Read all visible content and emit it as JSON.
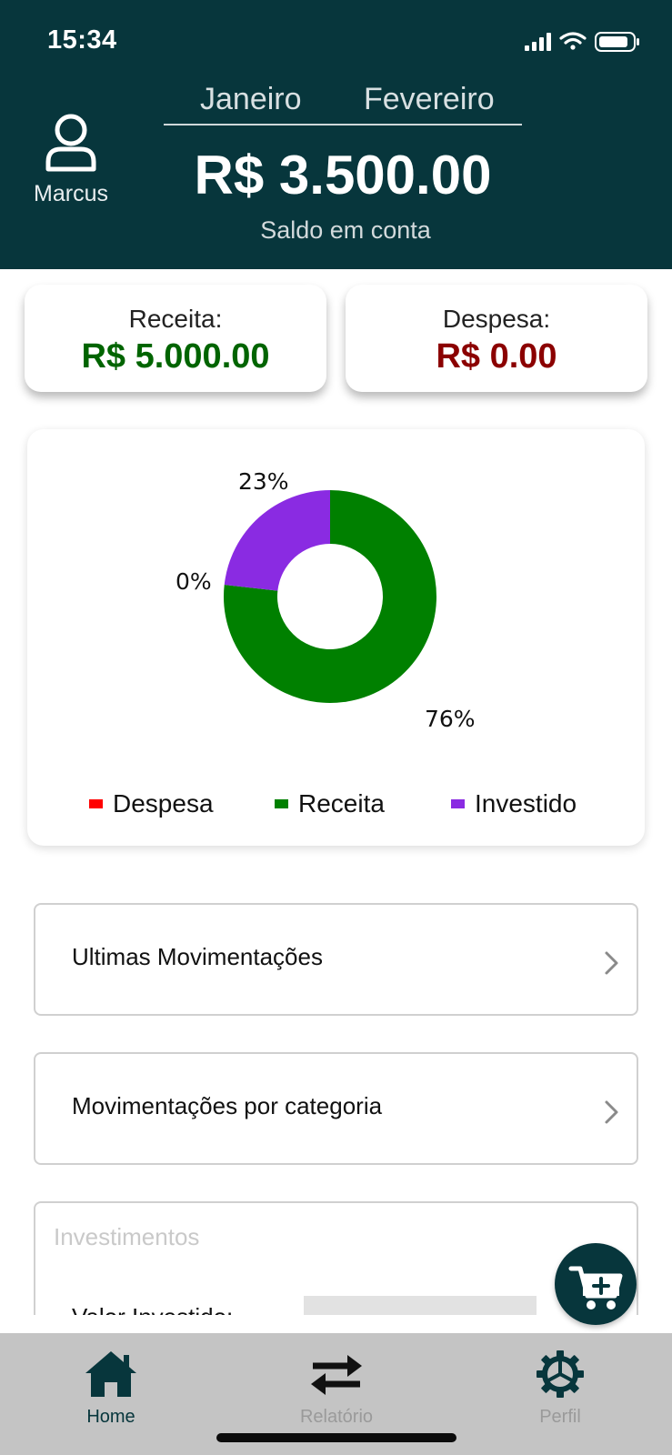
{
  "status_bar": {
    "time": "15:34"
  },
  "header": {
    "user_name": "Marcus",
    "months": [
      "Janeiro",
      "Fevereiro"
    ],
    "balance": "R$ 3.500.00",
    "balance_label": "Saldo em conta"
  },
  "summary": {
    "receita_label": "Receita:",
    "receita_value": "R$ 5.000.00",
    "despesa_label": "Despesa:",
    "despesa_value": "R$ 0.00",
    "receita_color": "#006400",
    "despesa_color": "#8B0000"
  },
  "chart_data": {
    "type": "pie",
    "categories": [
      "Despesa",
      "Receita",
      "Investido"
    ],
    "values": [
      0,
      76,
      23
    ],
    "labels": [
      "0%",
      "76%",
      "23%"
    ],
    "colors": [
      "#FF0000",
      "#008000",
      "#8A2BE2"
    ],
    "donut": true,
    "legend_position": "bottom"
  },
  "nav": {
    "ultimas": "Ultimas Movimentações",
    "categoria": "Movimentações por categoria"
  },
  "investments": {
    "title": "Investimentos",
    "valor_label": "Valor Investido:"
  },
  "tabbar": {
    "home": "Home",
    "relatorio": "Relatório",
    "perfil": "Perfil",
    "active_color": "#07363C",
    "inactive_color": "#9a9a9a"
  },
  "icons": {
    "user": "user-icon",
    "chevron": "chevron-right-icon",
    "fab": "cart-plus-icon",
    "home": "home-icon",
    "relatorio": "swap-arrows-icon",
    "perfil": "gear-icon"
  }
}
